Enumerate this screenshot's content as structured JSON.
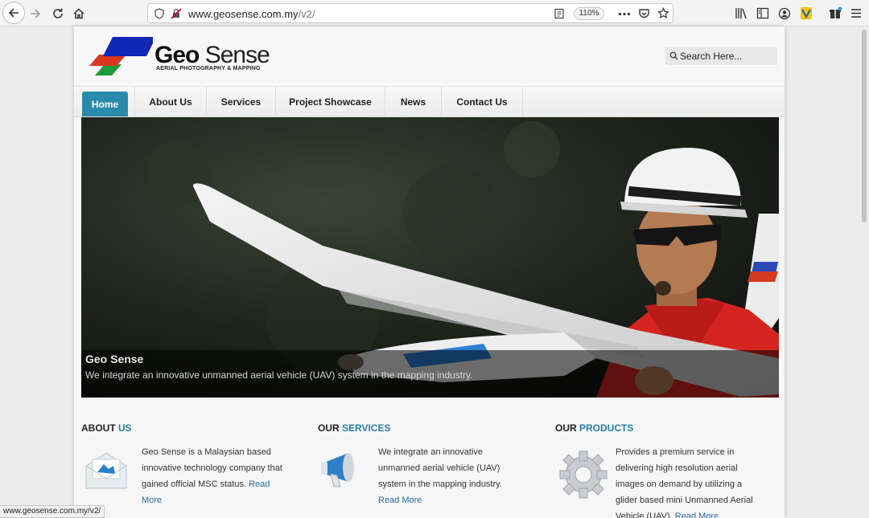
{
  "browser": {
    "url_host": "www.geosense.com.my",
    "url_path": "/v2/",
    "zoom": "110%",
    "status_url": "www.geosense.com.my/v2/"
  },
  "header": {
    "logo_bold": "Geo",
    "logo_thin": "Sense",
    "logo_sub": "AERIAL PHOTOGRAPHY & MAPPING",
    "search_placeholder": "Search Here..."
  },
  "nav": {
    "items": [
      {
        "label": "Home"
      },
      {
        "label": "About Us"
      },
      {
        "label": "Services"
      },
      {
        "label": "Project Showcase"
      },
      {
        "label": "News"
      },
      {
        "label": "Contact Us"
      }
    ]
  },
  "hero": {
    "caption_title": "Geo Sense",
    "caption_text": "We integrate an innovative unmanned aerial vehicle (UAV) system in the mapping industry."
  },
  "columns": [
    {
      "head_plain": "ABOUT",
      "head_accent": "US",
      "text": "Geo Sense is a Malaysian based innovative technology company that gained official MSC status.",
      "link": "Read More"
    },
    {
      "head_plain": "OUR",
      "head_accent": "SERVICES",
      "text": "We integrate an innovative unmanned aerial vehicle (UAV) system in the mapping industry.",
      "link": "Read More"
    },
    {
      "head_plain": "OUR",
      "head_accent": "PRODUCTS",
      "text": "Provides a premium service in delivering high resolution aerial images on demand by utilizing a glider based mini Unmanned Aerial Vehicle (UAV).",
      "link": "Read More"
    }
  ],
  "colors": {
    "accent": "#2a8aaa",
    "heading_accent": "#2a7ea4"
  }
}
